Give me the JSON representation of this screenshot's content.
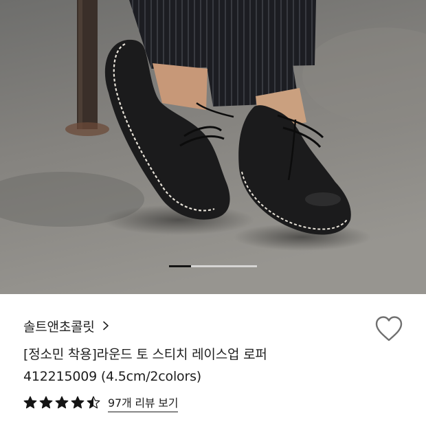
{
  "carousel": {
    "image_alt": "black round toe stitch lace-up loafers",
    "current_position": 0.25
  },
  "product": {
    "brand": "솔트앤초콜릿",
    "brand_chevron_icon": "chevron-right-icon",
    "wishlist_icon": "heart-outline-icon",
    "title_line1": "[정소민 착용]라운드 토 스티치 레이스업 로퍼",
    "title_line2": "412215009 (4.5cm/2colors)",
    "rating": 4.5,
    "rating_max": 5,
    "review_link": "97개 리뷰 보기"
  },
  "colors": {
    "text": "#1d1d1d",
    "star": "#141414",
    "heart_stroke": "#6f6f6f"
  }
}
